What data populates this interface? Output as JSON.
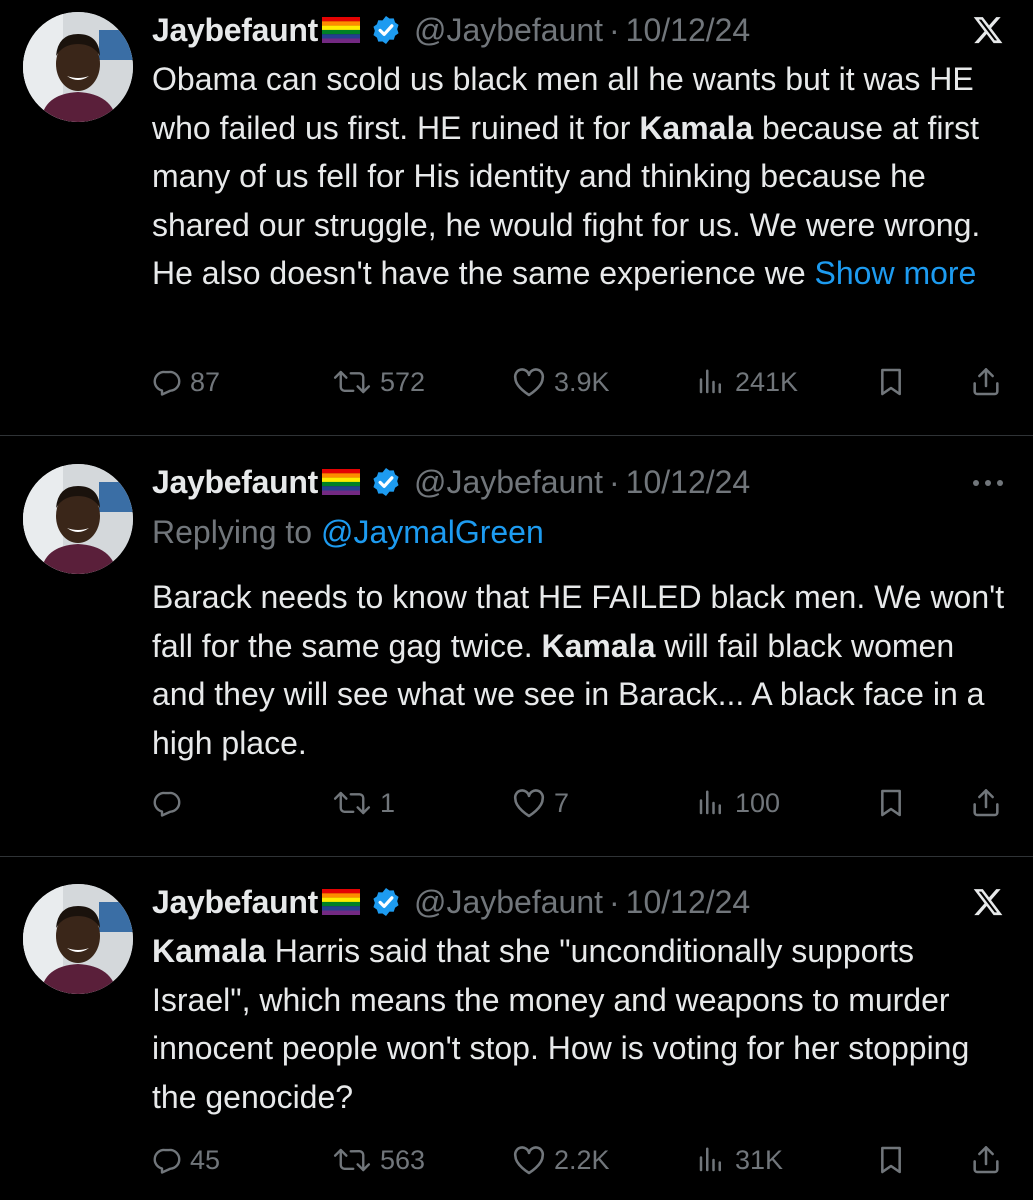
{
  "tweets": [
    {
      "name": "Jaybefaunt",
      "handle": "@Jaybefaunt",
      "dot": "·",
      "date": "10/12/24",
      "corner_icon": "x-logo-icon",
      "replying_prefix": "",
      "replying_mention": "",
      "segments": [
        {
          "t": "Obama can scold us black men all he wants but it was HE who failed us first. HE ruined it for ",
          "b": false
        },
        {
          "t": "Kamala",
          "b": true
        },
        {
          "t": " because at first many of us fell for His identity and thinking because he shared our struggle, he would fight for us. We were wrong. He also doesn't have the same experience we ",
          "b": false
        }
      ],
      "show_more": "Show more",
      "stats": {
        "replies": "87",
        "retweets": "572",
        "likes": "3.9K",
        "views": "241K"
      }
    },
    {
      "name": "Jaybefaunt",
      "handle": "@Jaybefaunt",
      "dot": "·",
      "date": "10/12/24",
      "corner_icon": "more-options-icon",
      "replying_prefix": "Replying to ",
      "replying_mention": "@JaymalGreen",
      "segments": [
        {
          "t": "Barack needs to know that HE FAILED black men. We won't fall for the same gag twice. ",
          "b": false
        },
        {
          "t": "Kamala",
          "b": true
        },
        {
          "t": " will fail black women and they will see what we see in Barack... A black face in a high place.",
          "b": false
        }
      ],
      "show_more": "",
      "stats": {
        "replies": "",
        "retweets": "1",
        "likes": "7",
        "views": "100"
      }
    },
    {
      "name": "Jaybefaunt",
      "handle": "@Jaybefaunt",
      "dot": "·",
      "date": "10/12/24",
      "corner_icon": "x-logo-icon",
      "replying_prefix": "",
      "replying_mention": "",
      "segments": [
        {
          "t": "Kamala",
          "b": true
        },
        {
          "t": " Harris said that she \"unconditionally supports Israel\", which means the money and weapons to murder innocent people won't stop. How is voting for her stopping the genocide?",
          "b": false
        }
      ],
      "show_more": "",
      "stats": {
        "replies": "45",
        "retweets": "563",
        "likes": "2.2K",
        "views": "31K"
      }
    }
  ],
  "colors": {
    "background": "#000000",
    "text": "#e7e9ea",
    "muted": "#71767b",
    "link": "#1d9bf0",
    "verified": "#1d9bf0",
    "divider": "#2f3336"
  }
}
